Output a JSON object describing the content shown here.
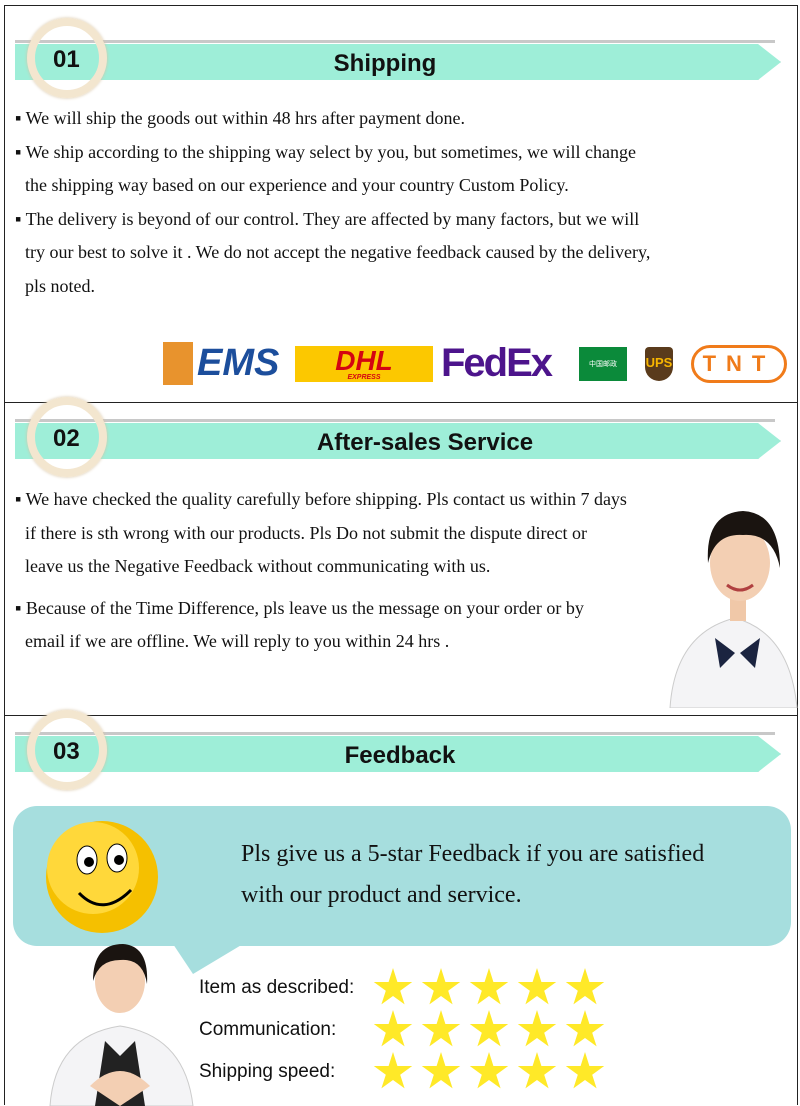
{
  "sections": [
    {
      "number": "01",
      "title": "Shipping",
      "bullets": [
        [
          "We will ship the goods out within 48 hrs after payment done."
        ],
        [
          "We ship according to the shipping way select by you, but sometimes, we will change",
          "the shipping way based on our experience and your country Custom Policy."
        ],
        [
          "The delivery is beyond of our control. They are affected by many factors, but we will",
          "try our best to solve it . We do not accept the negative feedback caused by the delivery,",
          "pls noted."
        ]
      ],
      "logos": [
        "EMS",
        "DHL",
        "EXPRESS",
        "FedEx",
        "中国邮政",
        "UPS",
        "TNT"
      ]
    },
    {
      "number": "02",
      "title": "After-sales Service",
      "bullets": [
        [
          "We have checked the quality carefully before shipping. Pls contact us  within 7 days",
          "if there is sth wrong with our products. Pls Do not submit the dispute direct or",
          "leave us the Negative Feedback without communicating with us."
        ],
        [
          "Because of the Time Difference, pls leave us the message on your order or by",
          "email if we  are offline. We will reply to you within 24 hrs ."
        ]
      ]
    },
    {
      "number": "03",
      "title": "Feedback",
      "message": [
        "Pls give us a 5-star Feedback if you are satisfied",
        "with our product and service."
      ],
      "ratings": [
        {
          "label": "Item as described:",
          "stars": 5
        },
        {
          "label": "Communication:",
          "stars": 5
        },
        {
          "label": "Shipping speed:",
          "stars": 5
        }
      ]
    }
  ],
  "colors": {
    "banner": "#9eeed8",
    "bubble": "#a6dede",
    "star": "#ffe928"
  }
}
